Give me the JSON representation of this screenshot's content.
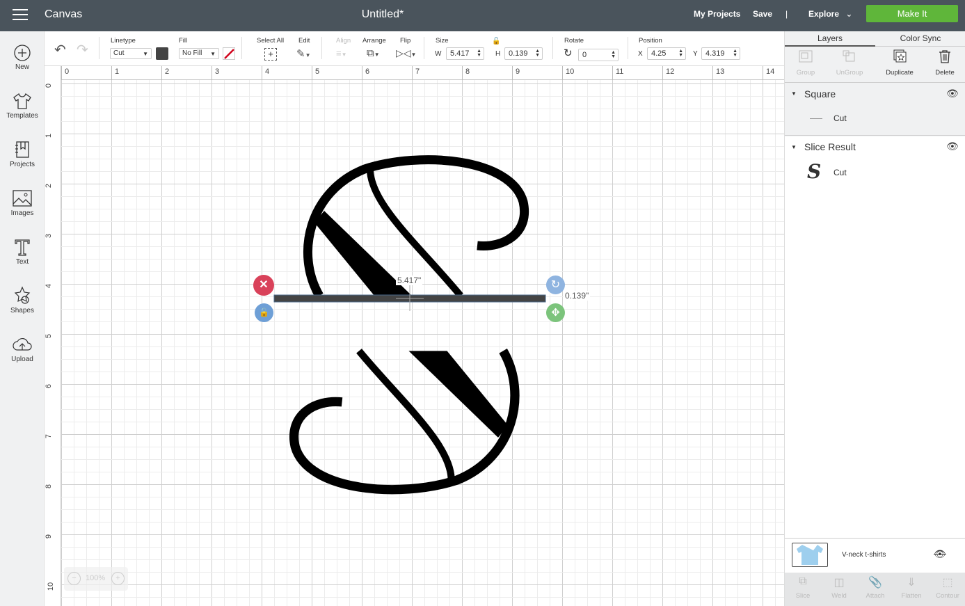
{
  "header": {
    "app_name": "Canvas",
    "title": "Untitled*",
    "my_projects": "My Projects",
    "save": "Save",
    "divider": "|",
    "explore": "Explore",
    "make_it": "Make It",
    "make_it_color": "#5fb63a"
  },
  "sidebar": {
    "items": [
      {
        "label": "New",
        "icon": "plus-circle-icon"
      },
      {
        "label": "Templates",
        "icon": "tshirt-icon"
      },
      {
        "label": "Projects",
        "icon": "notebook-icon"
      },
      {
        "label": "Images",
        "icon": "image-icon"
      },
      {
        "label": "Text",
        "icon": "text-icon"
      },
      {
        "label": "Shapes",
        "icon": "shapes-icon"
      },
      {
        "label": "Upload",
        "icon": "cloud-upload-icon"
      }
    ]
  },
  "toolbar": {
    "linetype_label": "Linetype",
    "linetype_value": "Cut",
    "fill_label": "Fill",
    "fill_value": "No Fill",
    "select_all": "Select All",
    "edit": "Edit",
    "align": "Align",
    "arrange": "Arrange",
    "flip": "Flip",
    "size_label": "Size",
    "w_label": "W",
    "w_value": "5.417",
    "h_label": "H",
    "h_value": "0.139",
    "rotate_label": "Rotate",
    "rotate_value": "0",
    "position_label": "Position",
    "x_label": "X",
    "x_value": "4.25",
    "y_label": "Y",
    "y_value": "4.319"
  },
  "canvas": {
    "h_ruler": [
      "0",
      "1",
      "2",
      "3",
      "4",
      "5",
      "6",
      "7",
      "8",
      "9",
      "10",
      "11",
      "12",
      "13",
      "14"
    ],
    "v_ruler": [
      "0",
      "1",
      "2",
      "3",
      "4",
      "5",
      "6",
      "7",
      "8",
      "9",
      "10"
    ],
    "width_readout": "5.417\"",
    "height_readout": "0.139\"",
    "zoom": "100%"
  },
  "panel": {
    "tabs": [
      "Layers",
      "Color Sync"
    ],
    "tools": [
      "Group",
      "UnGroup",
      "Duplicate",
      "Delete"
    ],
    "layers": [
      {
        "name": "Square",
        "items": [
          {
            "label": "Cut"
          }
        ]
      },
      {
        "name": "Slice Result",
        "items": [
          {
            "label": "Cut"
          }
        ]
      }
    ],
    "material": "V-neck t-shirts",
    "bottom_tools": [
      "Slice",
      "Weld",
      "Attach",
      "Flatten",
      "Contour"
    ]
  }
}
